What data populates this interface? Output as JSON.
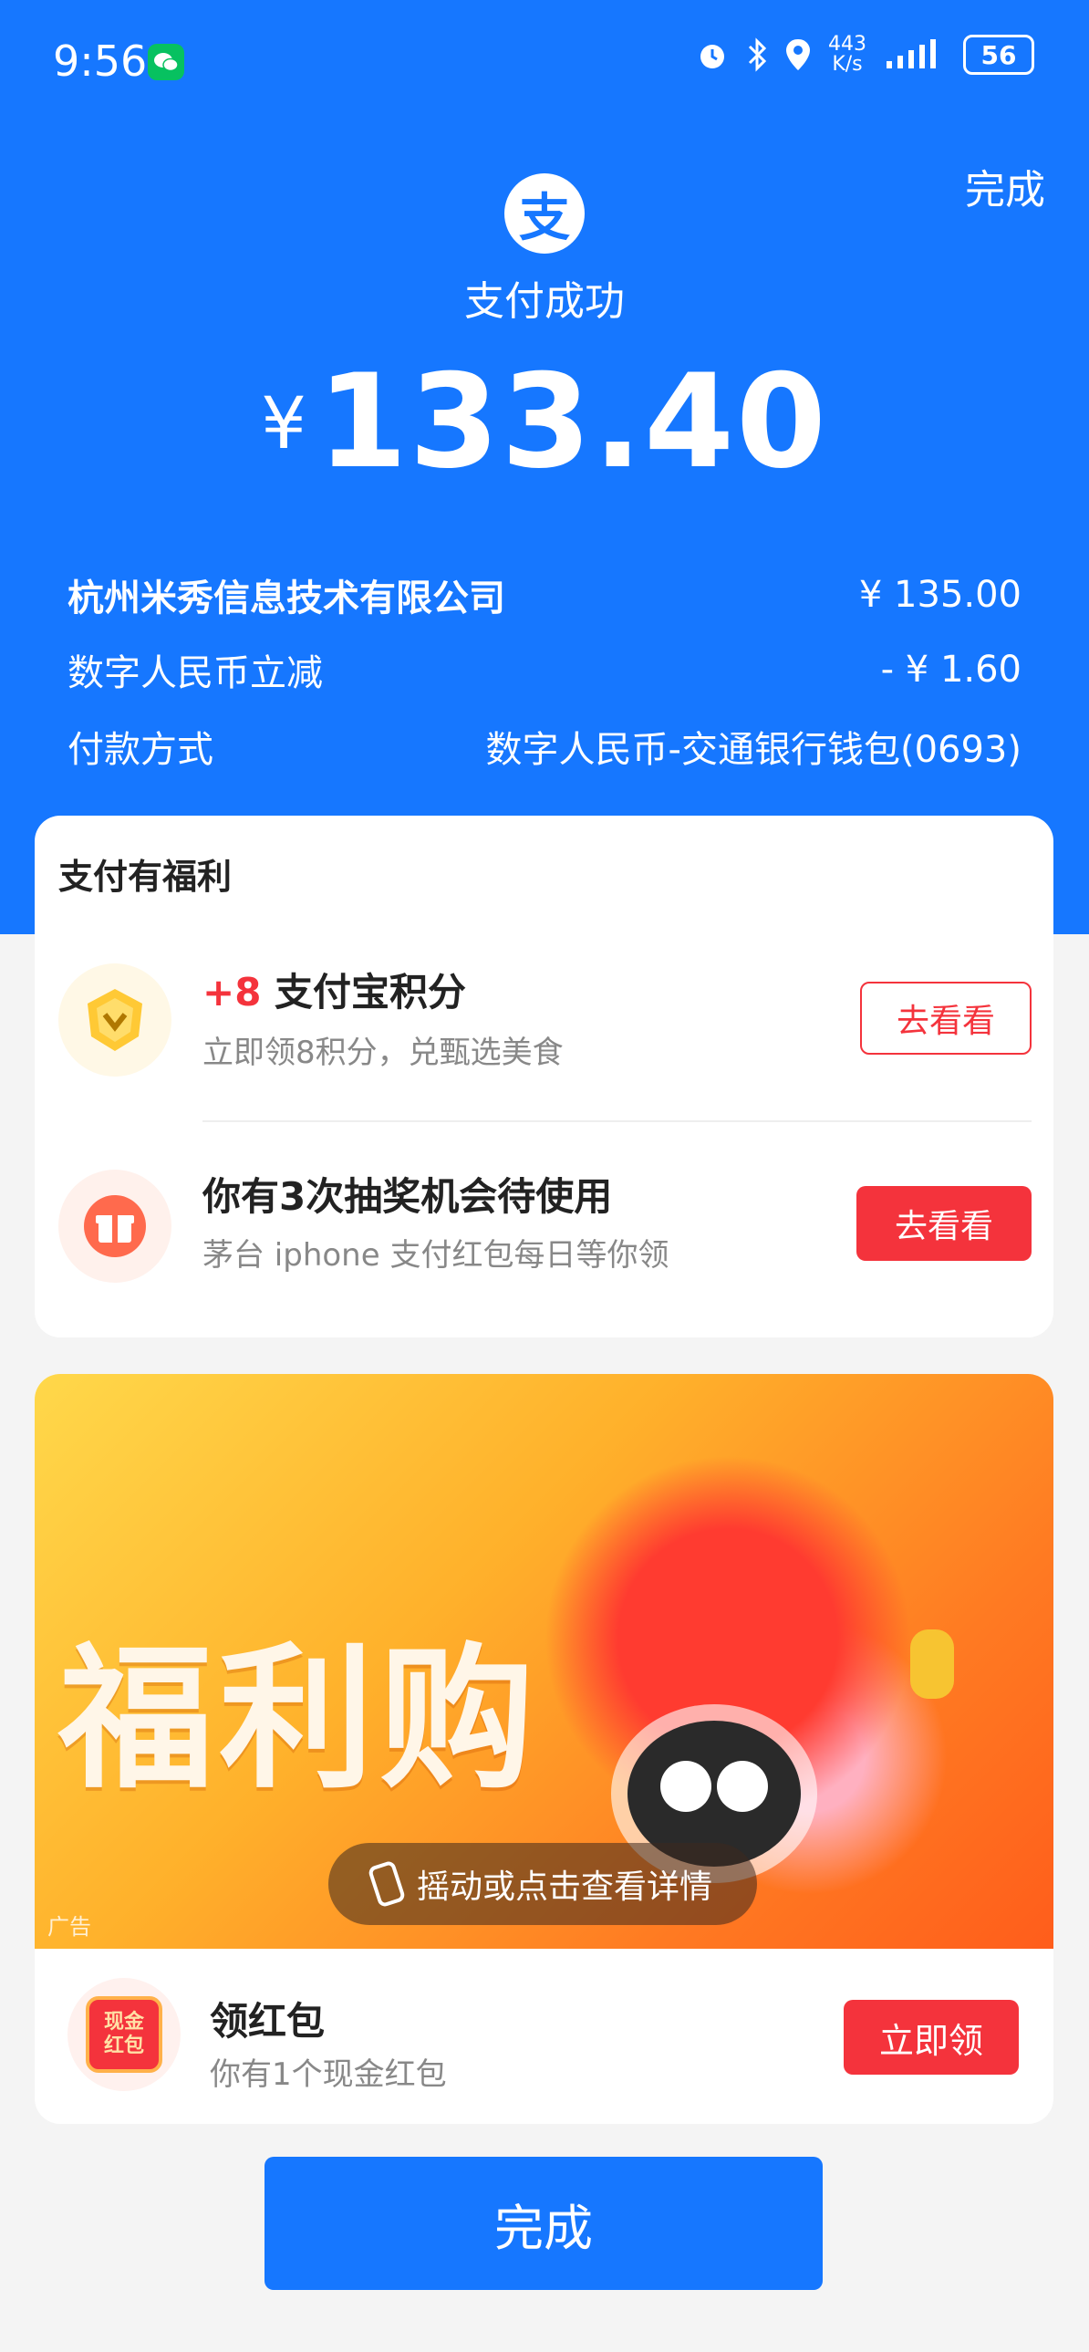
{
  "status_bar": {
    "time": "9:56",
    "net_speed_value": "443",
    "net_speed_unit": "K/s",
    "battery": "56"
  },
  "header": {
    "done_label": "完成",
    "logo_char": "支",
    "status_text": "支付成功",
    "currency": "¥",
    "amount": "133.40"
  },
  "details": [
    {
      "label": "杭州米秀信息技术有限公司",
      "value": "¥ 135.00"
    },
    {
      "label": "数字人民币立减",
      "value": "- ¥ 1.60"
    },
    {
      "label": "付款方式",
      "value": "数字人民币-交通银行钱包(0693)"
    }
  ],
  "benefits": {
    "title": "支付有福利",
    "items": [
      {
        "title_prefix": "+8",
        "title": " 支付宝积分",
        "subtitle": "立即领8积分，兑甄选美食",
        "button": "去看看"
      },
      {
        "title": "你有3次抽奖机会待使用",
        "subtitle": "茅台 iphone 支付红包每日等你领",
        "button": "去看看"
      }
    ]
  },
  "ad": {
    "banner_text": "福利购",
    "ad_label": "广告",
    "shake_text": "摇动或点击查看详情",
    "red_packet_icon_text": "现金\n红包",
    "red_packet_title": "领红包",
    "red_packet_subtitle": "你有1个现金红包",
    "claim_button": "立即领"
  },
  "footer": {
    "done_button": "完成"
  },
  "colors": {
    "brand_blue": "#1677ff",
    "alert_red": "#f4333c"
  },
  "icons": [
    "wechat-icon",
    "alarm-icon",
    "bluetooth-icon",
    "location-icon",
    "signal-icon",
    "battery-icon",
    "alipay-logo-icon",
    "points-coin-icon",
    "gift-icon",
    "phone-shake-icon",
    "red-packet-icon"
  ]
}
